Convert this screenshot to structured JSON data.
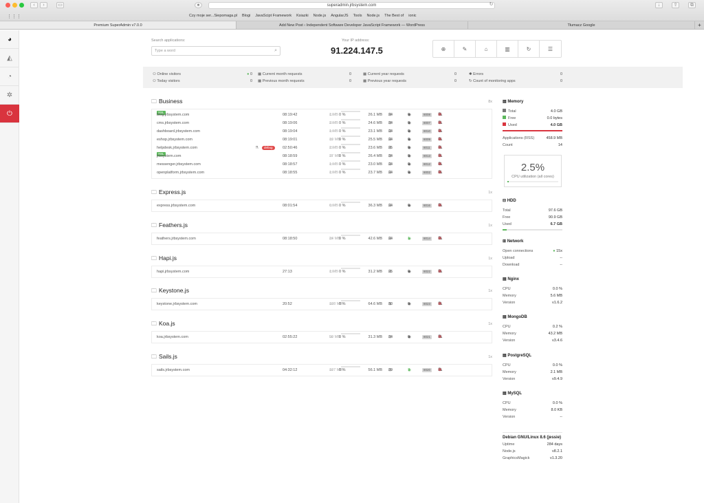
{
  "browser": {
    "url": "superadmin.jrbsystem.com",
    "bookmarks": [
      "Czy moje ser...Siepomaga.pl",
      "Blogi",
      "JavaScipt Framework",
      "Ksiazki",
      "Node.js",
      "AngularJS",
      "Tools",
      "Node.js",
      "The Best of",
      "ionic"
    ],
    "tabs": [
      "Premium SuperAdmin v7.0.0",
      "Add New Post ‹ Independent Software Developer JavaScript Framework — WordPress",
      "Tłumacz Google"
    ],
    "new_tab": "+"
  },
  "header": {
    "search_label": "Search applications:",
    "search_placeholder": "Type a word",
    "ip_label": "Your IP address:",
    "ip": "91.224.147.5"
  },
  "stats": [
    {
      "label": "Online visitors",
      "value": "0"
    },
    {
      "label": "Today visitors",
      "value": "0"
    },
    {
      "label": "Current month requests",
      "value": "0"
    },
    {
      "label": "Previous month requests",
      "value": "0"
    },
    {
      "label": "Current year requests",
      "value": "0"
    },
    {
      "label": "Previous year requests",
      "value": "0"
    },
    {
      "label": "Errors",
      "value": "0"
    },
    {
      "label": "Count of monitoring apps",
      "value": "0"
    }
  ],
  "groups": [
    {
      "name": "Business",
      "count": "8x",
      "apps": [
        {
          "name": "blog.jrbsystem.com",
          "ssl": "SSL",
          "time": "08:19:42",
          "mem": "1 MB",
          "cpu": "0 %",
          "ram": "26.1 MB",
          "threads": "24",
          "conns": "0",
          "port": "8008",
          "debug": ""
        },
        {
          "name": "cms.jrbsystem.com",
          "ssl": "",
          "time": "08:19:06",
          "mem": "2 MB",
          "cpu": "0 %",
          "ram": "24.6 MB",
          "threads": "24",
          "conns": "0",
          "port": "8007",
          "debug": ""
        },
        {
          "name": "dashboard.jrbsystem.com",
          "ssl": "",
          "time": "08:19:04",
          "mem": "1 MB",
          "cpu": "0 %",
          "ram": "23.1 MB",
          "threads": "24",
          "conns": "0",
          "port": "8010",
          "debug": ""
        },
        {
          "name": "eshop.jrbsystem.com",
          "ssl": "",
          "time": "08:19:01",
          "mem": "10 MB",
          "cpu": "0 %",
          "ram": "25.5 MB",
          "threads": "24",
          "conns": "0",
          "port": "8009",
          "debug": ""
        },
        {
          "name": "helpdesk.jrbsystem.com",
          "ssl": "",
          "time": "02:50:46",
          "mem": "2 MB",
          "cpu": "0 %",
          "ram": "23.6 MB",
          "threads": "25",
          "conns": "0",
          "port": "8011",
          "debug": "debug"
        },
        {
          "name": "jrbsystem.com",
          "ssl": "SSL",
          "time": "08:18:59",
          "mem": "37 MB",
          "cpu": "0 %",
          "ram": "26.4 MB",
          "threads": "24",
          "conns": "0",
          "port": "8013",
          "debug": ""
        },
        {
          "name": "messenger.jrbsystem.com",
          "ssl": "",
          "time": "08:18:57",
          "mem": "1 MB",
          "cpu": "0 %",
          "ram": "23.0 MB",
          "threads": "24",
          "conns": "0",
          "port": "8012",
          "debug": ""
        },
        {
          "name": "openplatform.jrbsystem.com",
          "ssl": "",
          "time": "08:18:55",
          "mem": "1 MB",
          "cpu": "0 %",
          "ram": "23.7 MB",
          "threads": "24",
          "conns": "0",
          "port": "8002",
          "debug": ""
        }
      ]
    },
    {
      "name": "Express.js",
      "count": "1x",
      "apps": [
        {
          "name": "express.jrbsystem.com",
          "ssl": "",
          "time": "08:01:54",
          "mem": "6 MB",
          "cpu": "0 %",
          "ram": "36.3 MB",
          "threads": "24",
          "conns": "0",
          "port": "8016",
          "debug": ""
        }
      ]
    },
    {
      "name": "Feathers.js",
      "count": "1x",
      "apps": [
        {
          "name": "feathers.jrbsystem.com",
          "ssl": "",
          "time": "08:18:50",
          "mem": "24 MB",
          "cpu": "0 %",
          "ram": "42.6 MB",
          "threads": "24",
          "conns": "1",
          "port": "8014",
          "debug": ""
        }
      ]
    },
    {
      "name": "Hapi.js",
      "count": "1x",
      "apps": [
        {
          "name": "hapi.jrbsystem.com",
          "ssl": "",
          "time": "27:13",
          "mem": "1 MB",
          "cpu": "0 %",
          "ram": "31.2 MB",
          "threads": "25",
          "conns": "0",
          "port": "8022",
          "debug": ""
        }
      ]
    },
    {
      "name": "Keystone.js",
      "count": "1x",
      "apps": [
        {
          "name": "keystone.jrbsystem.com",
          "ssl": "",
          "time": "20:52",
          "mem": "108 MB",
          "cpu": "0 %",
          "ram": "64.6 MB",
          "threads": "30",
          "conns": "0",
          "port": "8023",
          "debug": ""
        }
      ]
    },
    {
      "name": "Koa.js",
      "count": "1x",
      "apps": [
        {
          "name": "koa.jrbsystem.com",
          "ssl": "",
          "time": "02:55:22",
          "mem": "50 MB",
          "cpu": "0 %",
          "ram": "31.3 MB",
          "threads": "24",
          "conns": "0",
          "port": "8021",
          "debug": ""
        }
      ]
    },
    {
      "name": "Sails.js",
      "count": "1x",
      "apps": [
        {
          "name": "sails.jrbsystem.com",
          "ssl": "",
          "time": "04:32:12",
          "mem": "107 MB",
          "cpu": "0 %",
          "ram": "56.1 MB",
          "threads": "29",
          "conns": "7",
          "port": "8020",
          "debug": ""
        }
      ]
    }
  ],
  "memory": {
    "title": "Memory",
    "total_label": "Total",
    "total": "4.0 GB",
    "free_label": "Free",
    "free": "0.0 bytes",
    "used_label": "Used",
    "used": "4.0 GB",
    "apps_label": "Applications (RSS)",
    "apps": "458.9 MB",
    "count_label": "Count",
    "count": "14",
    "used_fraction": 1.0
  },
  "cpu": {
    "value": "2.5%",
    "label": "CPU utilization (all cores)",
    "fraction": 0.025
  },
  "hdd": {
    "title": "HDD",
    "total_label": "Total",
    "total": "97.6 GB",
    "free_label": "Free",
    "free": "90.9 GB",
    "used_label": "Used",
    "used": "6.7 GB",
    "used_fraction": 0.07
  },
  "network": {
    "title": "Network",
    "open_label": "Open connections",
    "open": "15x",
    "upload_label": "Upload",
    "upload": "--",
    "download_label": "Download",
    "download": "--"
  },
  "services": [
    {
      "title": "Nginx",
      "cpu": "0.0 %",
      "memory": "5.6 MB",
      "version": "v1.6.2"
    },
    {
      "title": "MongoDB",
      "cpu": "0.2 %",
      "memory": "43.2 MB",
      "version": "v3.4.6"
    },
    {
      "title": "PostgreSQL",
      "cpu": "0.0 %",
      "memory": "2.1 MB",
      "version": "v9.4.9"
    },
    {
      "title": "MySQL",
      "cpu": "0.0 %",
      "memory": "8.0 KB",
      "version": "--"
    }
  ],
  "service_labels": {
    "cpu": "CPU",
    "memory": "Memory",
    "version": "Version"
  },
  "system": {
    "title": "Debian GNU/Linux 8.6 (jessie)",
    "uptime_label": "Uptime",
    "uptime": "284 days",
    "node_label": "Node.js",
    "node": "v8.2.1",
    "gm_label": "GraphicsMagick",
    "gm": "v1.3.20"
  },
  "colors": {
    "accent_red": "#d9343e",
    "ssl_green": "#5cb85c",
    "legend_total": "#777777",
    "legend_free": "#5cb85c",
    "legend_used": "#d9343e"
  }
}
